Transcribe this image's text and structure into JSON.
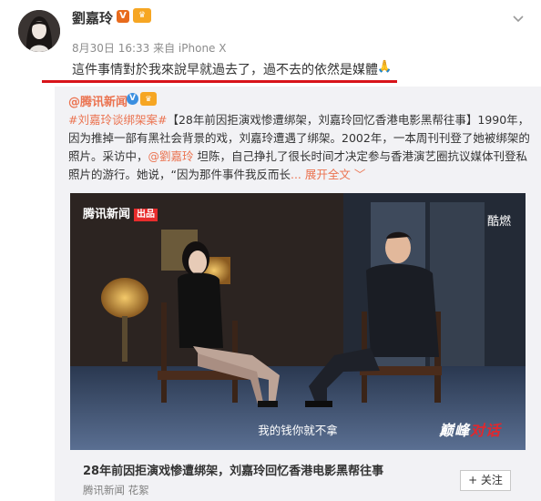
{
  "post": {
    "username": "劉嘉玲",
    "verified_badge": "V",
    "member_badge": "♛",
    "meta": "8月30日 16:33 来自 iPhone X",
    "text": "這件事情對於我來說早就過去了，過不去的依然是媒體",
    "emoji": "🙏",
    "highlight_color": "#d8141a"
  },
  "retweet": {
    "author": "@腾讯新闻",
    "verified_badge": "V",
    "member_badge": "♛",
    "hashtag": "#刘嘉玲谈绑架案#",
    "body": "【28年前因拒演戏惨遭绑架，刘嘉玲回忆香港电影黑帮往事】1990年，因为推掉一部有黑社会背景的戏，刘嘉玲遭遇了绑架。2002年，一本周刊刊登了她被绑架的照片。采访中，",
    "mention": "@劉嘉玲",
    "body_cont": " 坦陈，自己挣扎了很长时间才决定参与香港演艺圈抗议媒体刊登私照片的游行。她说，“因为那件事件我反而长",
    "expand": "... 展开全文 ﹀"
  },
  "video": {
    "logo": "腾讯新闻",
    "logo_tag": "出品",
    "watermark": "酷燃",
    "subtitle": "我的钱你就不拿",
    "brand_main": "巅峰",
    "brand_accent": "对话"
  },
  "preview": {
    "title": "28年前因拒演戏惨遭绑架，刘嘉玲回忆香港电影黑帮往事",
    "source": "腾讯新闻 花絮",
    "follow": "+ 关注"
  },
  "icons": {
    "menu": "chevron-down-icon",
    "play": "play-icon"
  },
  "colors": {
    "link": "#eb7350",
    "card_bg": "#f2f2f5"
  }
}
